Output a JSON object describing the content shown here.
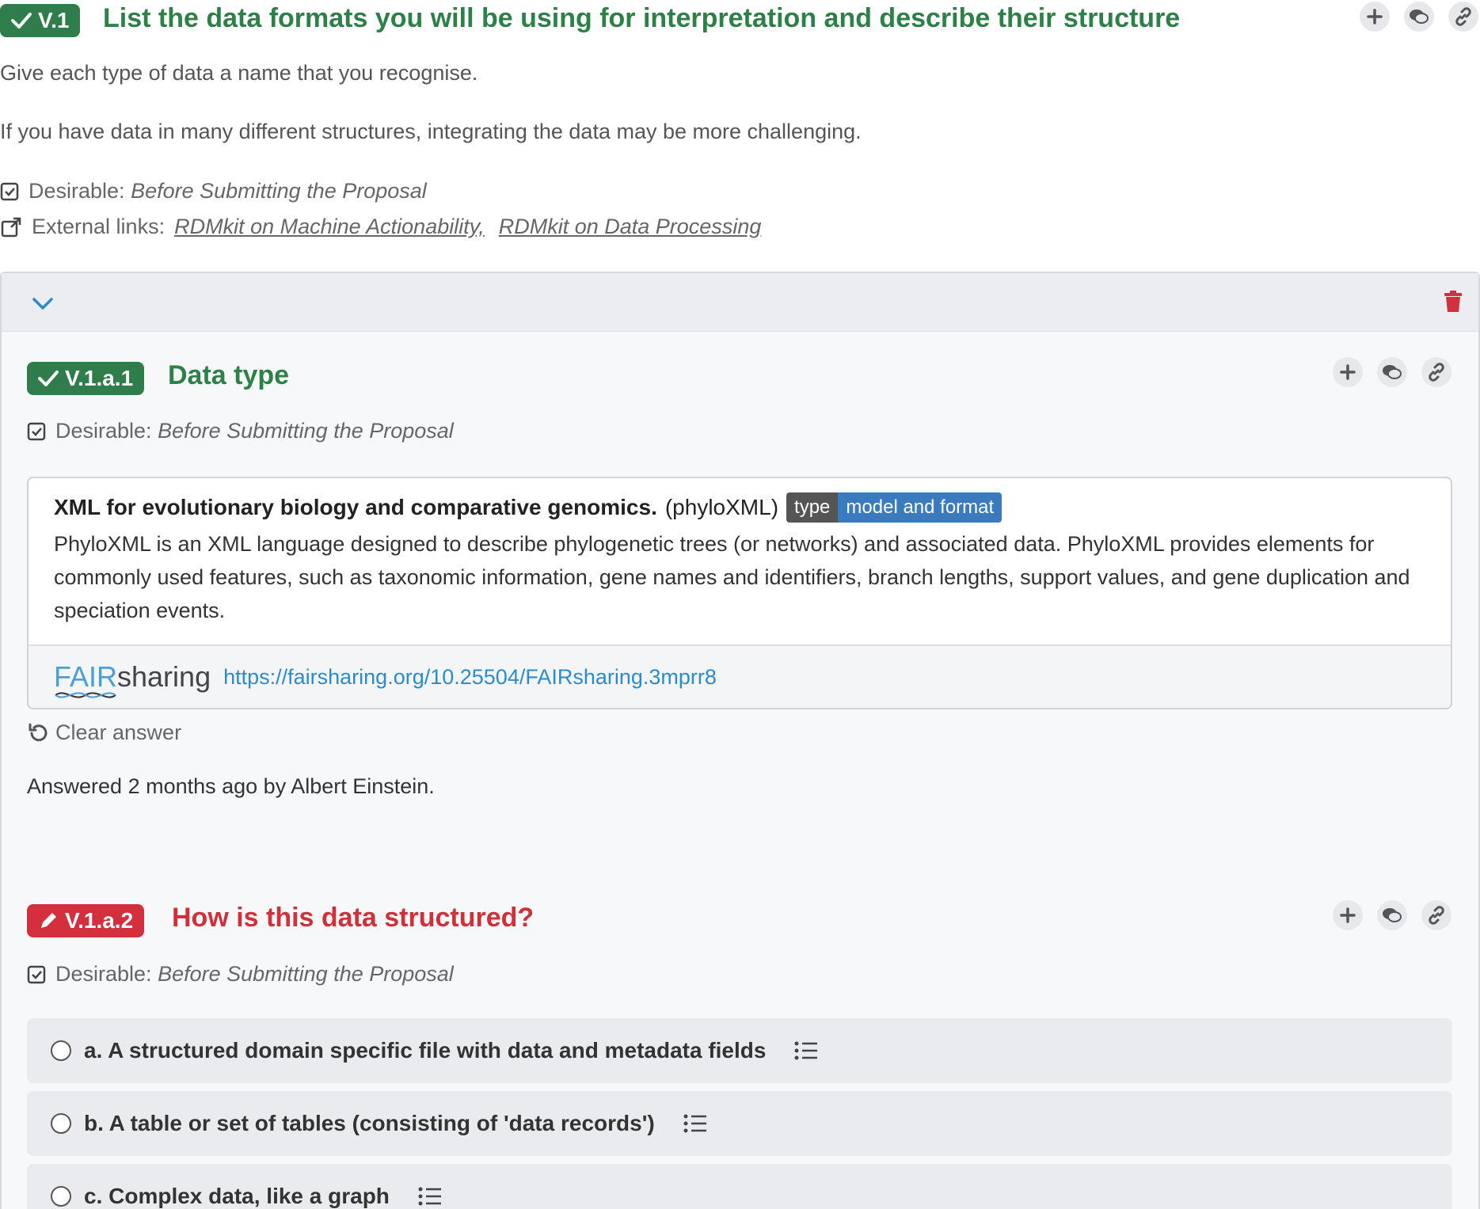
{
  "question": {
    "badge": "V.1",
    "title": "List the data formats you will be using for interpretation and describe their structure",
    "desc1": "Give each type of data a name that you recognise.",
    "desc2": "If you have data in many different structures, integrating the data may be more challenging.",
    "desirable_label": "Desirable:",
    "desirable_value": "Before Submitting the Proposal",
    "external_label": "External links:",
    "links": [
      "RDMkit on Machine Actionability,",
      "RDMkit on Data Processing"
    ]
  },
  "sub1": {
    "badge": "V.1.a.1",
    "title": "Data type",
    "desirable_label": "Desirable:",
    "desirable_value": "Before Submitting the Proposal",
    "answer": {
      "title_bold": "XML for evolutionary biology and comparative genomics.",
      "title_abbr": "(phyloXML)",
      "tag_key": "type",
      "tag_value": "model and format",
      "description": "PhyloXML is an XML language designed to describe phylogenetic trees (or networks) and associated data. PhyloXML provides elements for commonly used features, such as taxonomic information, gene names and identifiers, branch lengths, support values, and gene duplication and speciation events.",
      "logo_fair": "FAIR",
      "logo_sharing": "sharing",
      "url": "https://fairsharing.org/10.25504/FAIRsharing.3mprr8"
    },
    "clear_label": "Clear answer",
    "answered_text": "Answered 2 months ago by Albert Einstein."
  },
  "sub2": {
    "badge": "V.1.a.2",
    "title": "How is this data structured?",
    "desirable_label": "Desirable:",
    "desirable_value": "Before Submitting the Proposal",
    "options": [
      "a. A structured domain specific file with data and metadata fields",
      "b. A table or set of tables (consisting of 'data records')",
      "c. Complex data, like a graph"
    ]
  },
  "colors": {
    "success": "#2e7d4a",
    "danger": "#d32f3c",
    "link": "#2b8ccc",
    "tag_dark": "#555555",
    "tag_blue": "#3a7bbf"
  },
  "icons": [
    "check-icon",
    "plus-icon",
    "comments-icon",
    "link-icon",
    "checkbox-icon",
    "external-link-icon",
    "chevron-down-icon",
    "trash-icon",
    "pencil-icon",
    "undo-icon",
    "list-icon"
  ]
}
